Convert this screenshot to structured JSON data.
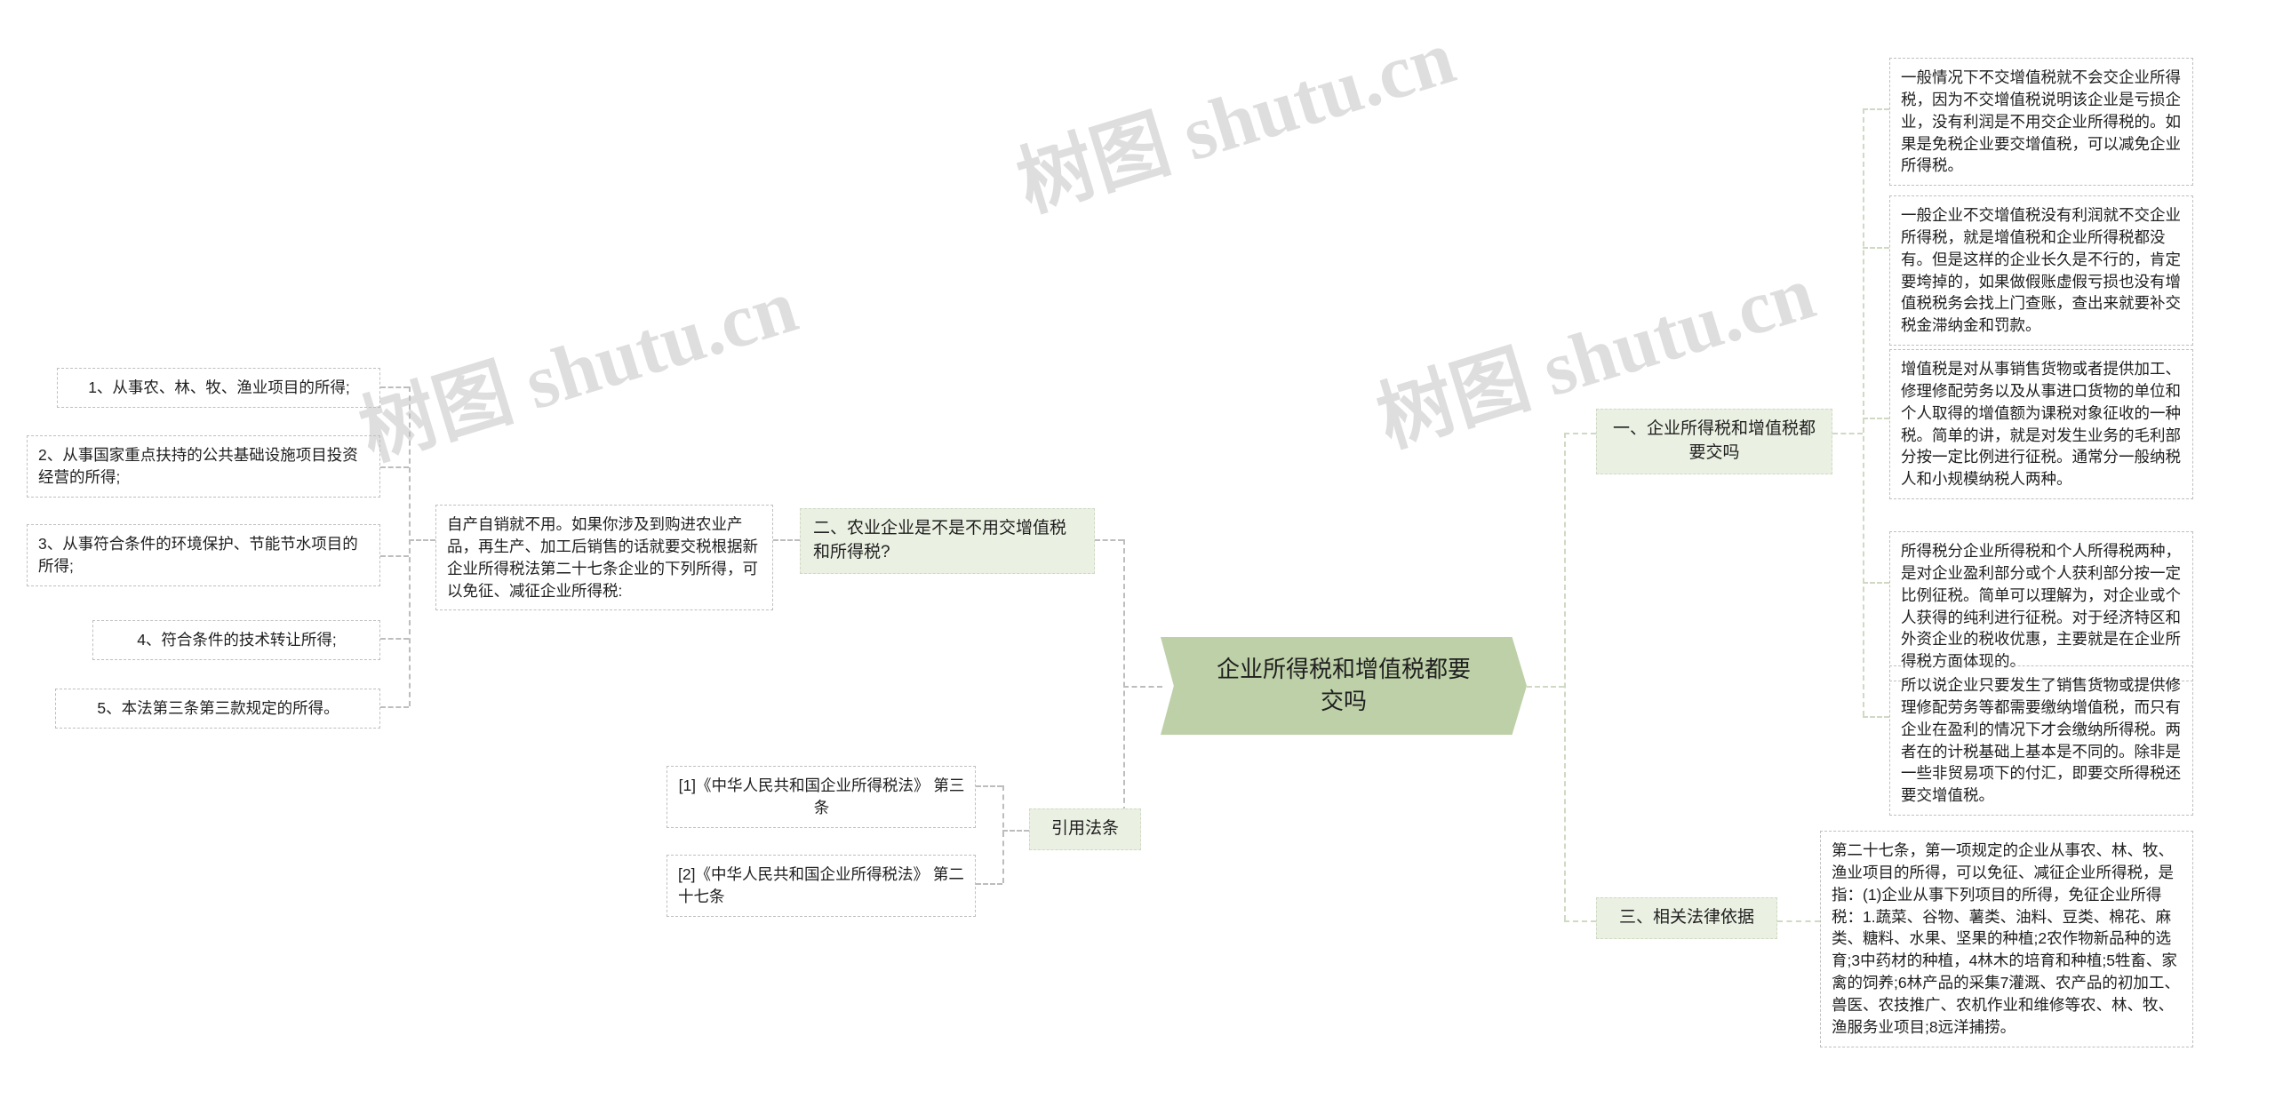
{
  "meta": {
    "watermark": "树图 shutu.cn",
    "accent_green": "#bed0a8",
    "node_green": "#eaf0e2",
    "border_gray": "#bfbfbf"
  },
  "central": {
    "label": "企业所得税和增值税都要交吗"
  },
  "right_branch": [
    {
      "label": "一、企业所得税和增值税都要交吗",
      "children": [
        "一般情况下不交增值税就不会交企业所得税，因为不交增值税说明该企业是亏损企业，没有利润是不用交企业所得税的。如果是免税企业要交增值税，可以减免企业所得税。",
        "一般企业不交增值税没有利润就不交企业所得税，就是增值税和企业所得税都没有。但是这样的企业长久是不行的，肯定要垮掉的，如果做假账虚假亏损也没有增值税税务会找上门查账，查出来就要补交税金滞纳金和罚款。",
        "增值税是对从事销售货物或者提供加工、修理修配劳务以及从事进口货物的单位和个人取得的增值额为课税对象征收的一种税。简单的讲，就是对发生业务的毛利部分按一定比例进行征税。通常分一般纳税人和小规模纳税人两种。",
        "所得税分企业所得税和个人所得税两种，是对企业盈利部分或个人获利部分按一定比例征税。简单可以理解为，对企业或个人获得的纯利进行征税。对于经济特区和外资企业的税收优惠，主要就是在企业所得税方面体现的。",
        "所以说企业只要发生了销售货物或提供修理修配劳务等都需要缴纳增值税，而只有企业在盈利的情况下才会缴纳所得税。两者在的计税基础上基本是不同的。除非是一些非贸易项下的付汇，即要交所得税还要交增值税。"
      ]
    },
    {
      "label": "三、相关法律依据",
      "children": [
        "第二十七条，第一项规定的企业从事农、林、牧、渔业项目的所得，可以免征、减征企业所得税，是指：(1)企业从事下列项目的所得，免征企业所得税：1.蔬菜、谷物、薯类、油料、豆类、棉花、麻类、糖料、水果、坚果的种植;2农作物新品种的选育;3中药材的种植，4林木的培育和种植;5牲畜、家禽的饲养;6林产品的采集7灌溉、农产品的初加工、兽医、农技推广、农机作业和维修等农、林、牧、渔服务业项目;8远洋捕捞。"
      ]
    }
  ],
  "left_branch": [
    {
      "label": "二、农业企业是不是不用交增值税和所得税?",
      "detail": "自产自销就不用。如果你涉及到购进农业产品，再生产、加工后销售的话就要交税根据新企业所得税法第二十七条企业的下列所得，可以免征、减征企业所得税:",
      "children": [
        "1、从事农、林、牧、渔业项目的所得;",
        "2、从事国家重点扶持的公共基础设施项目投资经营的所得;",
        "3、从事符合条件的环境保护、节能节水项目的所得;",
        "4、符合条件的技术转让所得;",
        "5、本法第三条第三款规定的所得。"
      ]
    },
    {
      "label": "引用法条",
      "children": [
        "[1]《中华人民共和国企业所得税法》 第三条",
        "[2]《中华人民共和国企业所得税法》 第二十七条"
      ]
    }
  ]
}
